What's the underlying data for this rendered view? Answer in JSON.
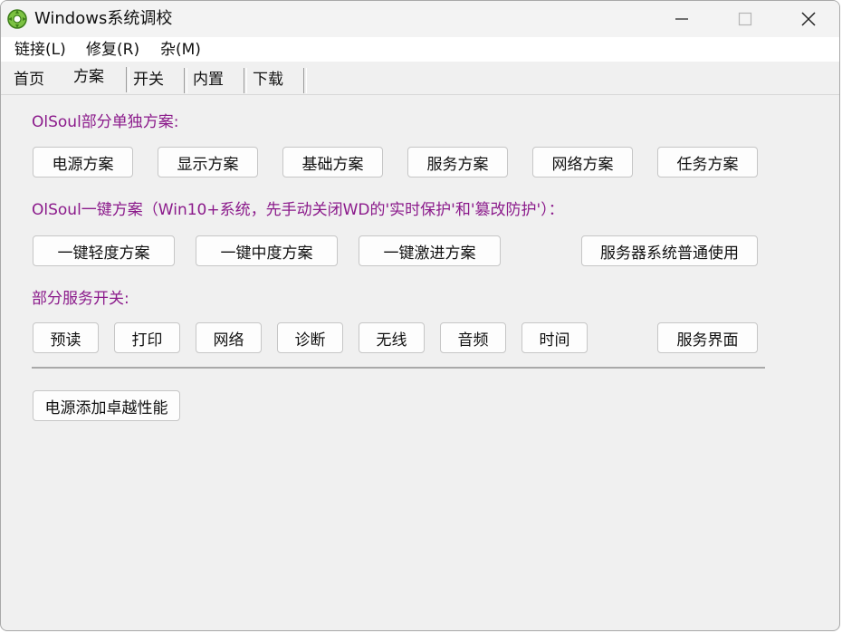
{
  "window": {
    "title": "Windows系统调校",
    "controls": {
      "minimize_icon": "minimize-icon",
      "maximize_icon": "maximize-icon",
      "close_icon": "close-icon"
    }
  },
  "menubar": {
    "items": [
      {
        "label": "链接(L)"
      },
      {
        "label": "修复(R)"
      },
      {
        "label": "杂(M)"
      }
    ]
  },
  "tabs": {
    "active": "方案",
    "items": [
      {
        "label": "首页"
      },
      {
        "label": "方案"
      },
      {
        "label": "开关"
      },
      {
        "label": "内置"
      },
      {
        "label": "下载"
      }
    ]
  },
  "sections": {
    "individual": {
      "label": "OlSoul部分单独方案:",
      "buttons": [
        "电源方案",
        "显示方案",
        "基础方案",
        "服务方案",
        "网络方案",
        "任务方案"
      ]
    },
    "onekey": {
      "label": "OlSoul一键方案（Win10+系统，先手动关闭WD的'实时保护'和'篡改防护'）：",
      "buttons": [
        "一键轻度方案",
        "一键中度方案",
        "一键激进方案",
        "服务器系统普通使用"
      ]
    },
    "services": {
      "label": "部分服务开关:",
      "buttons": [
        "预读",
        "打印",
        "网络",
        "诊断",
        "无线",
        "音频",
        "时间",
        "服务界面"
      ]
    },
    "power": {
      "button": "电源添加卓越性能"
    }
  },
  "colors": {
    "section_label": "#8b1a8b",
    "window_bg": "#f0f0f0",
    "button_bg": "#fdfdfd"
  }
}
